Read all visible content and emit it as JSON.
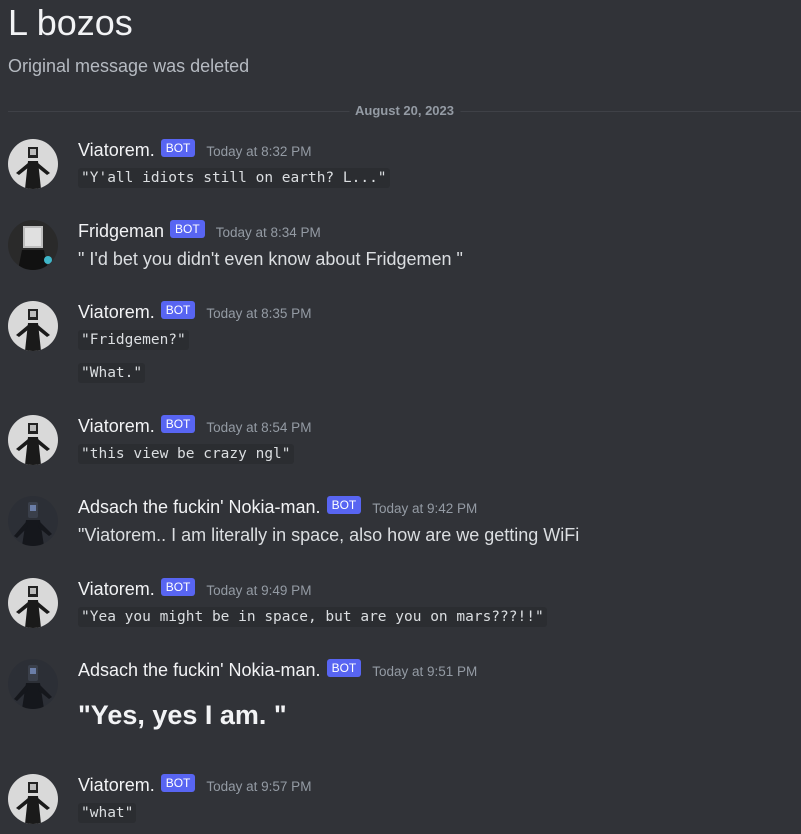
{
  "thread": {
    "title": "L bozos",
    "subtitle": "Original message was deleted"
  },
  "divider": {
    "date": "August 20, 2023"
  },
  "bot_tag": "BOT",
  "messages": [
    {
      "author": "Viatorem.",
      "time": "Today at 8:32 PM",
      "lines": [
        "\"Y'all idiots still on earth? L...\""
      ]
    },
    {
      "author": "Fridgeman",
      "time": "Today at 8:34 PM",
      "lines": [
        "\" I'd bet you didn't even know about Fridgemen \""
      ]
    },
    {
      "author": "Viatorem.",
      "time": "Today at 8:35 PM",
      "lines": [
        "\"Fridgemen?\"",
        "\"What.\""
      ]
    },
    {
      "author": "Viatorem.",
      "time": "Today at 8:54 PM",
      "lines": [
        "\"this view be crazy ngl\""
      ]
    },
    {
      "author": "Adsach the fuckin' Nokia-man.",
      "time": "Today at 9:42 PM",
      "lines": [
        "\"Viatorem.. I am literally in space, also how are we getting WiFi"
      ]
    },
    {
      "author": "Viatorem.",
      "time": "Today at 9:49 PM",
      "lines": [
        "\"Yea you might be in space, but are you on mars???!!\""
      ]
    },
    {
      "author": "Adsach the fuckin' Nokia-man.",
      "time": "Today at 9:51 PM",
      "lines": [
        "\"Yes, yes I am. \""
      ]
    },
    {
      "author": "Viatorem.",
      "time": "Today at 9:57 PM",
      "lines": [
        "\"what\""
      ]
    }
  ],
  "colors": {
    "background": "#313338",
    "bot_tag": "#5865f2",
    "code_background": "#2b2d31",
    "muted_text": "#949ba4"
  }
}
